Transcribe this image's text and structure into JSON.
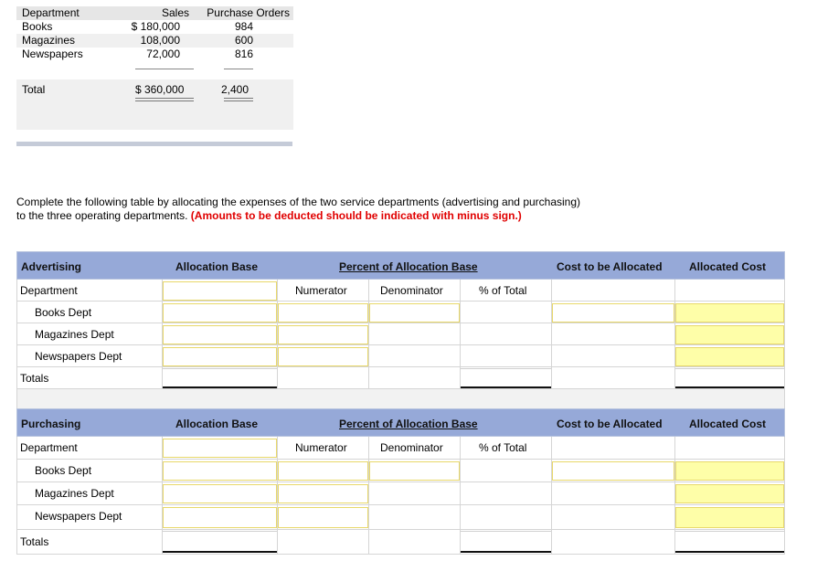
{
  "summary": {
    "headers": {
      "department": "Department",
      "sales": "Sales",
      "purchase_orders": "Purchase Orders"
    },
    "rows": [
      {
        "department": "Books",
        "sales": "$ 180,000",
        "purchase_orders": "984"
      },
      {
        "department": "Magazines",
        "sales": "108,000",
        "purchase_orders": "600"
      },
      {
        "department": "Newspapers",
        "sales": "72,000",
        "purchase_orders": "816"
      }
    ],
    "total": {
      "label": "Total",
      "sales": "$ 360,000",
      "purchase_orders": "2,400"
    }
  },
  "instructions": {
    "text": "Complete the following table by allocating the expenses of the two service departments (advertising and purchasing) to the three operating departments.",
    "emphasis": "(Amounts to be deducted should be indicated with minus sign.)"
  },
  "columns": {
    "allocation_base": "Allocation Base",
    "percent_of_allocation_base": "Percent of Allocation Base",
    "cost_to_be_allocated": "Cost to be Allocated",
    "allocated_cost": "Allocated Cost",
    "numerator": "Numerator",
    "denominator": "Denominator",
    "percent_of_total": "% of Total"
  },
  "tables": [
    {
      "title": "Advertising",
      "department_label": "Department",
      "rows": [
        "Books Dept",
        "Magazines Dept",
        "Newspapers Dept"
      ],
      "totals_label": "Totals"
    },
    {
      "title": "Purchasing",
      "department_label": "Department",
      "rows": [
        "Books Dept",
        "Magazines Dept",
        "Newspapers Dept"
      ],
      "totals_label": "Totals"
    }
  ],
  "colors": {
    "header_blue": "#96a9d8",
    "input_border": "#e8d86a",
    "result_yellow": "#fefea8",
    "emphasis_red": "#e00000"
  }
}
